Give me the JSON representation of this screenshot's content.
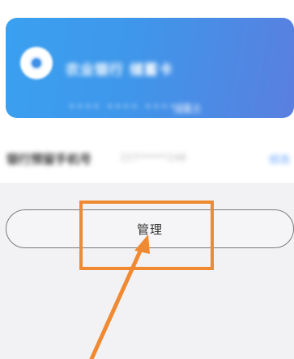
{
  "bank_card": {
    "logo_icon": "bank-logo-icon",
    "name": "农业银行 储蓄卡",
    "number_masked": "•••• •••• ••••",
    "card_type_link": "储蓄卡"
  },
  "settings_row": {
    "title": "银行预留手机号",
    "description": "157******248",
    "action_link": "修改"
  },
  "manage_button": {
    "label": "管理"
  },
  "annotation": {
    "highlight_color": "#f08a32",
    "arrow_color": "#f08a32"
  },
  "colors": {
    "card_gradient_start": "#3aa0f0",
    "card_gradient_end": "#5a7fe0",
    "page_background": "#f2f2f4"
  }
}
